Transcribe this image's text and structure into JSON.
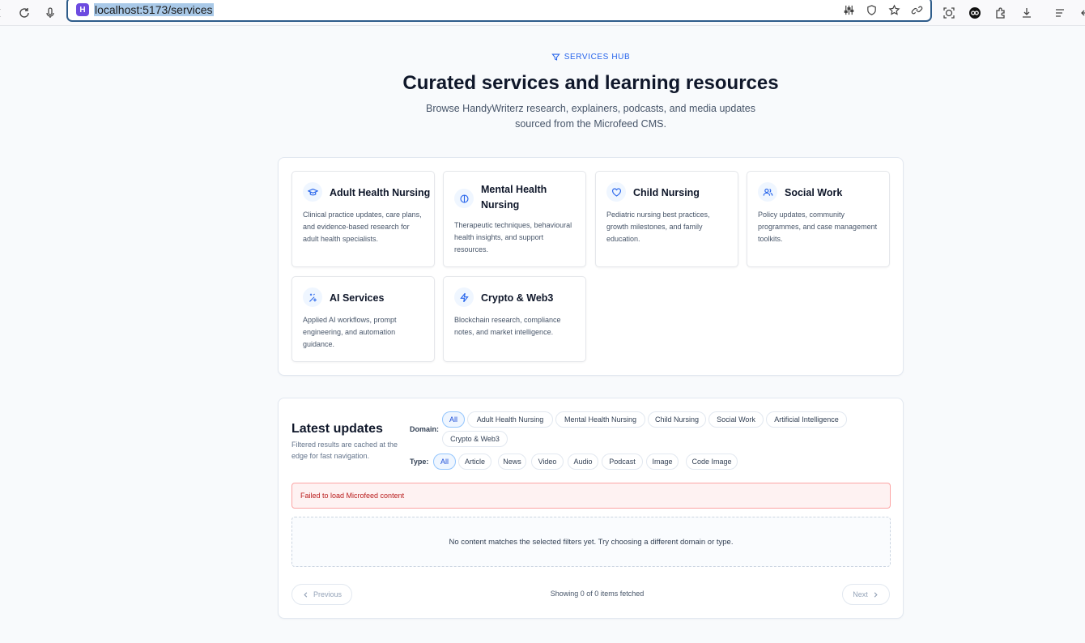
{
  "browser": {
    "url": "localhost:5173/services",
    "favicon_letter": "H"
  },
  "hero": {
    "eyebrow": "SERVICES HUB",
    "title": "Curated services and learning resources",
    "subtitle": "Browse HandyWriterz research, explainers, podcasts, and media updates sourced from the Microfeed CMS."
  },
  "services": [
    {
      "title": "Adult Health Nursing",
      "icon": "graduation-cap-icon",
      "description": "Clinical practice updates, care plans, and evidence-based research for adult health specialists."
    },
    {
      "title": "Mental Health Nursing",
      "icon": "brain-icon",
      "description": "Therapeutic techniques, behavioural health insights, and support resources."
    },
    {
      "title": "Child Nursing",
      "icon": "heart-icon",
      "description": "Pediatric nursing best practices, growth milestones, and family education."
    },
    {
      "title": "Social Work",
      "icon": "users-icon",
      "description": "Policy updates, community programmes, and case management toolkits."
    },
    {
      "title": "AI Services",
      "icon": "sparkles-icon",
      "description": "Applied AI workflows, prompt engineering, and automation guidance."
    },
    {
      "title": "Crypto & Web3",
      "icon": "lightning-icon",
      "description": "Blockchain research, compliance notes, and market intelligence."
    }
  ],
  "updates": {
    "title": "Latest updates",
    "subtitle": "Filtered results are cached at the edge for fast navigation.",
    "domain_label": "Domain:",
    "type_label": "Type:",
    "domains": [
      "All",
      "Adult Health Nursing",
      "Mental Health Nursing",
      "Child Nursing",
      "Social Work",
      "Artificial Intelligence",
      "Crypto & Web3"
    ],
    "types": [
      "All",
      "Article",
      "News",
      "Video",
      "Audio",
      "Podcast",
      "Image",
      "Code Image"
    ],
    "active_domain": "All",
    "active_type": "All",
    "error": "Failed to load Microfeed content",
    "empty": "No content matches the selected filters yet. Try choosing a different domain or type.",
    "previous": "Previous",
    "next": "Next",
    "pager_info": "Showing 0 of 0 items fetched"
  },
  "colors": {
    "accent": "#2563eb",
    "error_bg": "#fef2f2",
    "error_text": "#b91c1c"
  }
}
